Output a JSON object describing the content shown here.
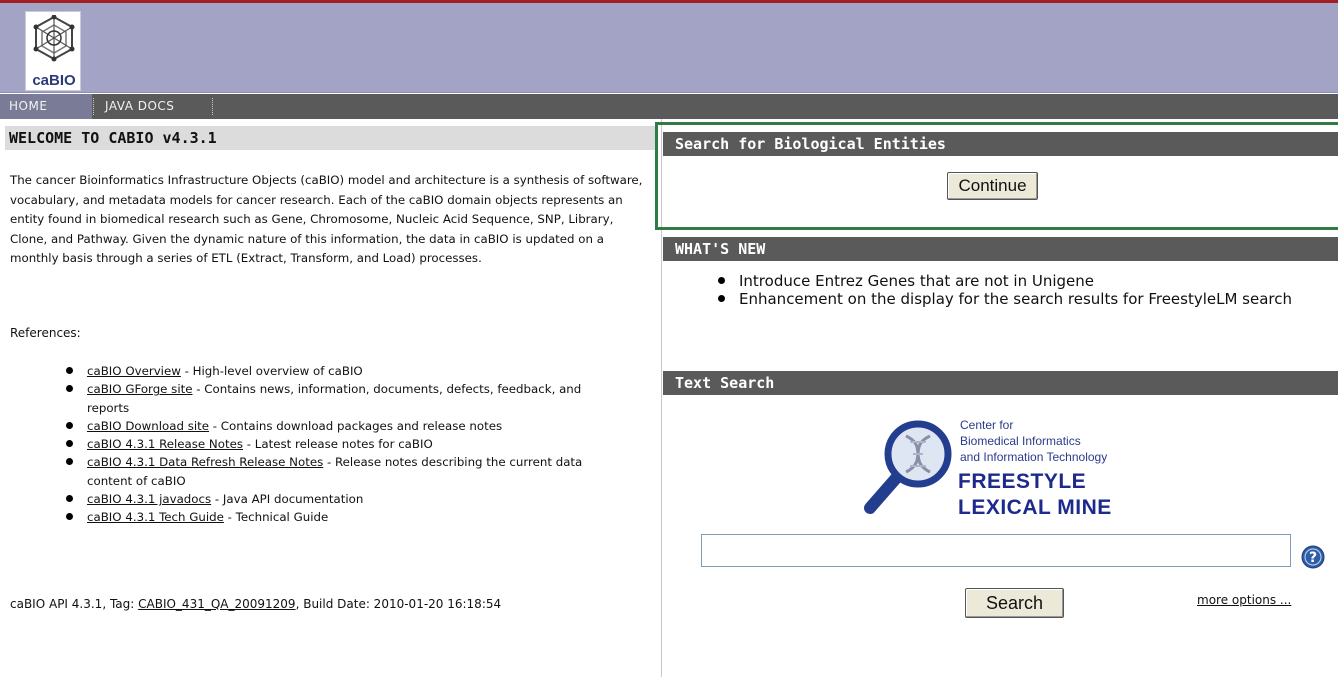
{
  "header": {
    "logo_text": "caBIO"
  },
  "nav": {
    "items": [
      {
        "label": "HOME"
      },
      {
        "label": "JAVA DOCS"
      }
    ]
  },
  "welcome": {
    "title": "WELCOME TO CABIO v4.3.1",
    "intro": "The cancer Bioinformatics Infrastructure Objects (caBIO) model and architecture is a synthesis of software, vocabulary, and metadata models for cancer research. Each of the caBIO domain objects represents an entity found in biomedical research such as Gene, Chromosome, Nucleic Acid Sequence, SNP, Library, Clone, and Pathway. Given the dynamic nature of this information, the data in caBIO is updated on a monthly basis through a series of ETL (Extract, Transform, and Load) processes.",
    "references_label": "References:",
    "references": [
      {
        "link": "caBIO Overview",
        "desc": " - High-level overview of caBIO"
      },
      {
        "link": "caBIO GForge site",
        "desc": " - Contains news, information, documents, defects, feedback, and reports"
      },
      {
        "link": "caBIO Download site",
        "desc": " - Contains download packages and release notes"
      },
      {
        "link": "caBIO 4.3.1 Release Notes",
        "desc": " - Latest release notes for caBIO"
      },
      {
        "link": "caBIO 4.3.1 Data Refresh Release Notes",
        "desc": " - Release notes describing the current data content of caBIO"
      },
      {
        "link": "caBIO 4.3.1 javadocs",
        "desc": " - Java API documentation"
      },
      {
        "link": "caBIO 4.3.1 Tech Guide",
        "desc": " - Technical Guide"
      }
    ],
    "build_prefix": "caBIO API 4.3.1, Tag: ",
    "build_tag": "CABIO_431_QA_20091209",
    "build_suffix": ", Build Date: 2010-01-20 16:18:54"
  },
  "search_entities": {
    "title": "Search for Biological Entities",
    "continue_label": "Continue"
  },
  "whats_new": {
    "title": "WHAT'S NEW",
    "items": [
      "Introduce Entrez Genes that are not in Unigene",
      "Enhancement on the display for the search results for FreestyleLM search"
    ]
  },
  "text_search": {
    "title": "Text Search",
    "logo_line1": "Center for",
    "logo_line2": "Biomedical Informatics",
    "logo_line3": "and Information Technology",
    "logo_big1": "FREESTYLE",
    "logo_big2": "LEXICAL MINE",
    "input_value": "",
    "search_label": "Search",
    "more_options": "more options ..."
  },
  "colors": {
    "header_bg": "#a3a4c5",
    "nav_bg": "#5a5a5a",
    "section_header_bg": "#5a5a5a",
    "highlight_border": "#2f7d42",
    "top_rule": "#a31e21"
  },
  "icons": {
    "logo": "cabio-molecule-logo",
    "help": "help-question-icon",
    "magnifier": "magnifying-glass-dna-icon"
  }
}
